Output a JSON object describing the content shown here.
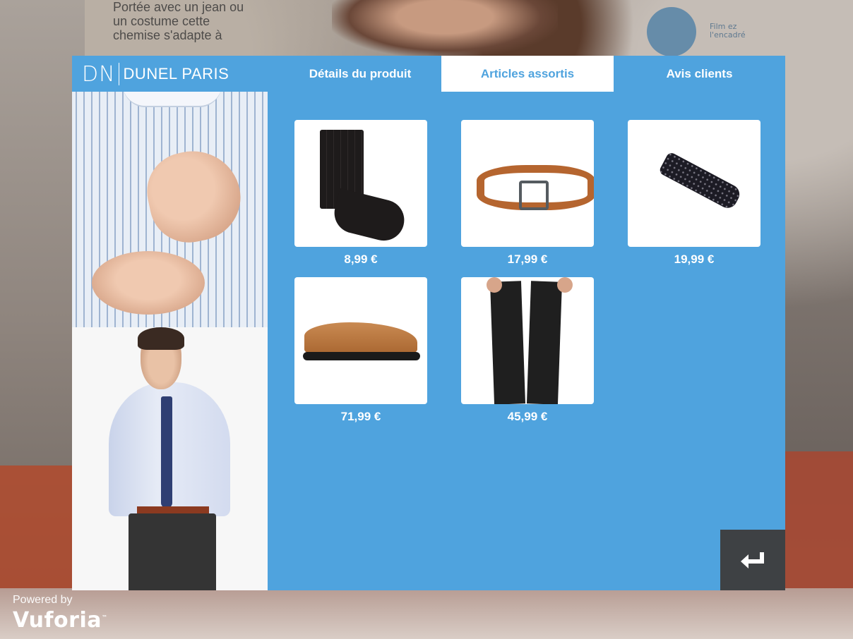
{
  "brand": {
    "monogram": "DN",
    "name": "DUNEL PARIS"
  },
  "tabs": [
    {
      "label": "Détails du produit",
      "active": false
    },
    {
      "label": "Articles assortis",
      "active": true
    },
    {
      "label": "Avis clients",
      "active": false
    }
  ],
  "products": [
    {
      "icon": "socks-image",
      "price": "8,99 €"
    },
    {
      "icon": "belt-image",
      "price": "17,99 €"
    },
    {
      "icon": "tie-image",
      "price": "19,99 €"
    },
    {
      "icon": "shoe-image",
      "price": "71,99 €"
    },
    {
      "icon": "trousers-image",
      "price": "45,99 €"
    }
  ],
  "back_button": {
    "icon": "return-arrow-icon"
  },
  "background": {
    "magazine_text": [
      "Portée avec un jean ou",
      "un costume cette",
      "chemise s'adapte à"
    ],
    "film_text": [
      "Film ez",
      "l'encadré"
    ],
    "watermark_powered": "Powered by",
    "watermark_brand": "Vuforia",
    "watermark_tm": "™"
  },
  "colors": {
    "panel_blue": "#4fa3de",
    "tab_active_bg": "#ffffff",
    "back_button_bg": "#3e4144"
  }
}
